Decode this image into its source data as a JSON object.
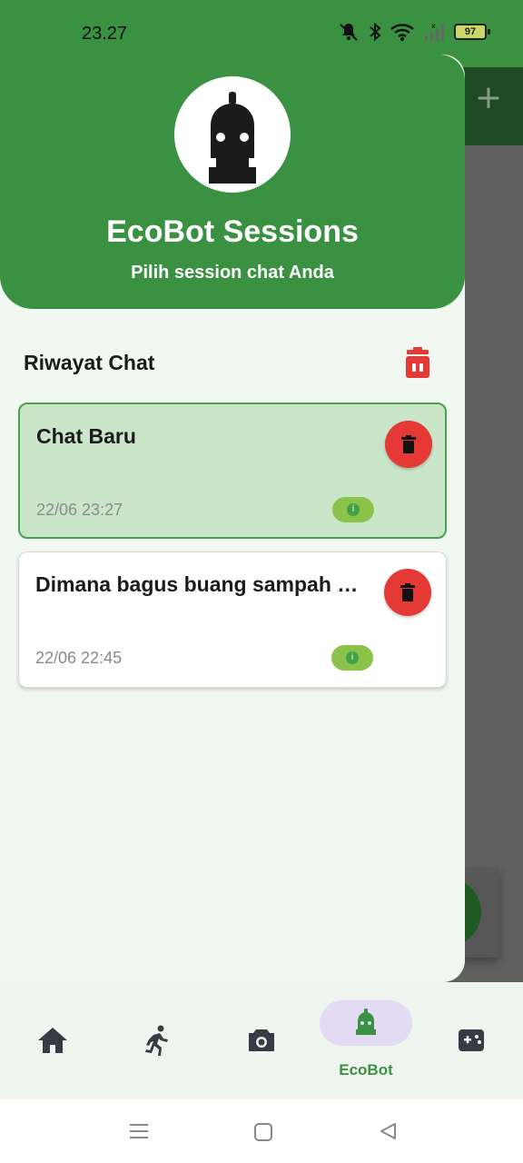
{
  "status_bar": {
    "time": "23.27",
    "battery": "97"
  },
  "drawer": {
    "title": "EcoBot Sessions",
    "subtitle": "Pilih session chat Anda",
    "section_title": "Riwayat Chat",
    "sessions": [
      {
        "title": "Chat Baru",
        "date": "22/06 23:27",
        "active": true
      },
      {
        "title": "Dimana bagus buang sampah …",
        "date": "22/06 22:45",
        "active": false
      }
    ]
  },
  "bottom_nav": {
    "items": [
      {
        "icon": "home-icon"
      },
      {
        "icon": "running-icon"
      },
      {
        "icon": "camera-icon"
      },
      {
        "icon": "robot-icon",
        "label": "EcoBot",
        "selected": true
      },
      {
        "icon": "game-controller-icon"
      }
    ]
  },
  "colors": {
    "primary_green": "#3a9142",
    "delete_red": "#e53935",
    "active_card": "#c9e6c9"
  }
}
